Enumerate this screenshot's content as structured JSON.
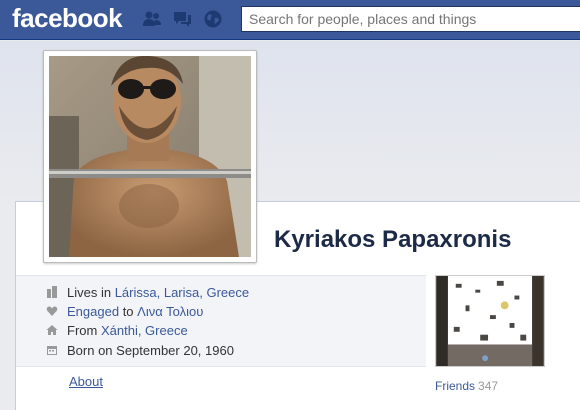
{
  "header": {
    "logo": "facebook",
    "search_placeholder": "Search for people, places and things"
  },
  "profile": {
    "name": "Kyriakos Papaxronis"
  },
  "info": {
    "lives_prefix": "Lives in",
    "lives_place": "Lárissa, Larisa, Greece",
    "engaged_prefix": "Engaged",
    "engaged_to": "to",
    "engaged_person": "Λινα Τολιου",
    "from_prefix": "From",
    "from_place": "Xánthi, Greece",
    "born": "Born on September 20, 1960"
  },
  "about_link": "About",
  "friends": {
    "label": "Friends",
    "count": "347"
  },
  "colors": {
    "brand_blue": "#3b5998",
    "link": "#3b5998",
    "name": "#1c2a47"
  },
  "icons": {
    "friend_requests": "friend-requests-icon",
    "messages": "messages-icon",
    "notifications": "globe-icon",
    "lives": "building-icon",
    "engaged": "heart-icon",
    "from": "house-icon",
    "born": "calendar-icon"
  }
}
